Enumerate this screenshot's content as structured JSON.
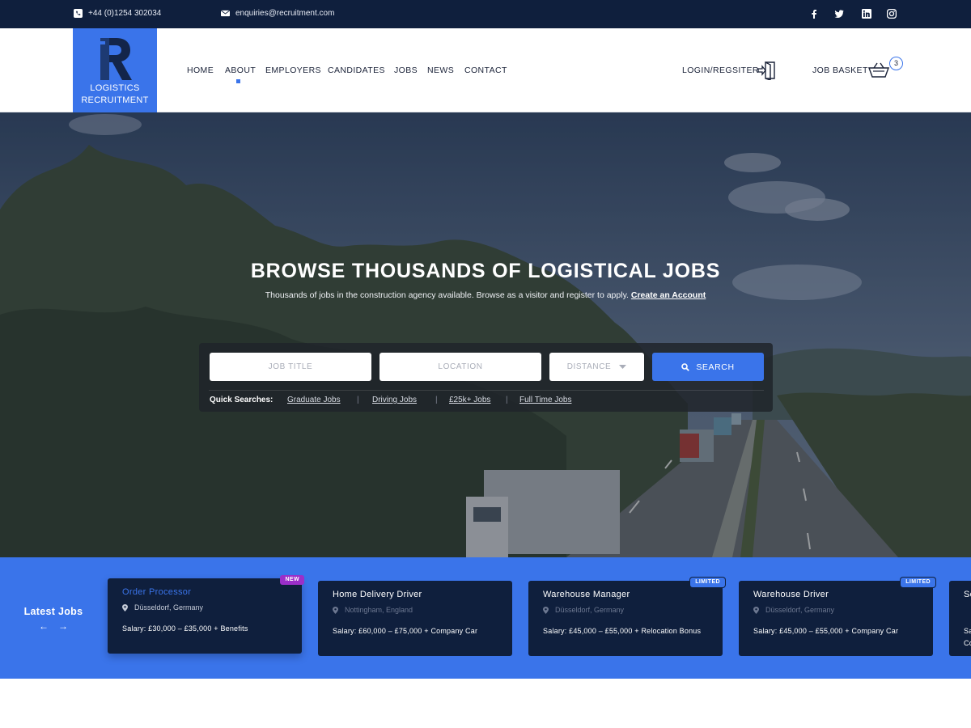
{
  "topbar": {
    "phone": "+44 (0)1254 302034",
    "email": "enquiries@recruitment.com",
    "social": [
      "facebook-icon",
      "twitter-icon",
      "linkedin-icon",
      "instagram-icon"
    ]
  },
  "logo": {
    "line1": "LOGISTICS",
    "line2": "RECRUITMENT",
    "letter": "R"
  },
  "nav": {
    "items": [
      "HOME",
      "ABOUT",
      "EMPLOYERS",
      "CANDIDATES",
      "JOBS",
      "NEWS",
      "CONTACT"
    ],
    "active": "ABOUT",
    "login": "LOGIN/REGSITER",
    "basket": "JOB BASKET",
    "basket_count": "3"
  },
  "hero": {
    "title": "BROWSE THOUSANDS OF LOGISTICAL JOBS",
    "subtitle": "Thousands of jobs in the construction agency available. Browse as a visitor and register to apply.",
    "subtitle_link": "Create an Account"
  },
  "search": {
    "job_title_placeholder": "JOB TITLE",
    "location_placeholder": "LOCATION",
    "distance_label": "DISTANCE",
    "button": "SEARCH",
    "quick_label": "Quick Searches:",
    "quick_links": [
      "Graduate Jobs",
      "Driving Jobs",
      "£25k+ Jobs",
      "Full Time Jobs"
    ]
  },
  "latest": {
    "title": "Latest Jobs",
    "prev": "←",
    "next": "→",
    "cards": [
      {
        "title": "Order Processor",
        "location": "Düsseldorf, Germany",
        "salary": "Salary: £30,000 – £35,000 + Benefits",
        "tag": "NEW"
      },
      {
        "title": "Home Delivery Driver",
        "location": "Nottingham, England",
        "salary": "Salary: £60,000 – £75,000 + Company Car",
        "tag": ""
      },
      {
        "title": "Warehouse Manager",
        "location": "Düsseldorf, Germany",
        "salary": "Salary: £45,000 – £55,000 + Relocation Bonus",
        "tag": "LIMITED"
      },
      {
        "title": "Warehouse Driver",
        "location": "Düsseldorf, Germany",
        "salary": "Salary: £45,000 – £55,000 + Company Car",
        "tag": "LIMITED"
      },
      {
        "title": "Se",
        "location": "",
        "salary": "Sa Co",
        "tag": ""
      }
    ]
  },
  "colors": {
    "brand": "#3a74ea",
    "navy": "#0f1f3d",
    "tag_new": "#9b2fc9",
    "tag_limited": "#3a74ea"
  }
}
